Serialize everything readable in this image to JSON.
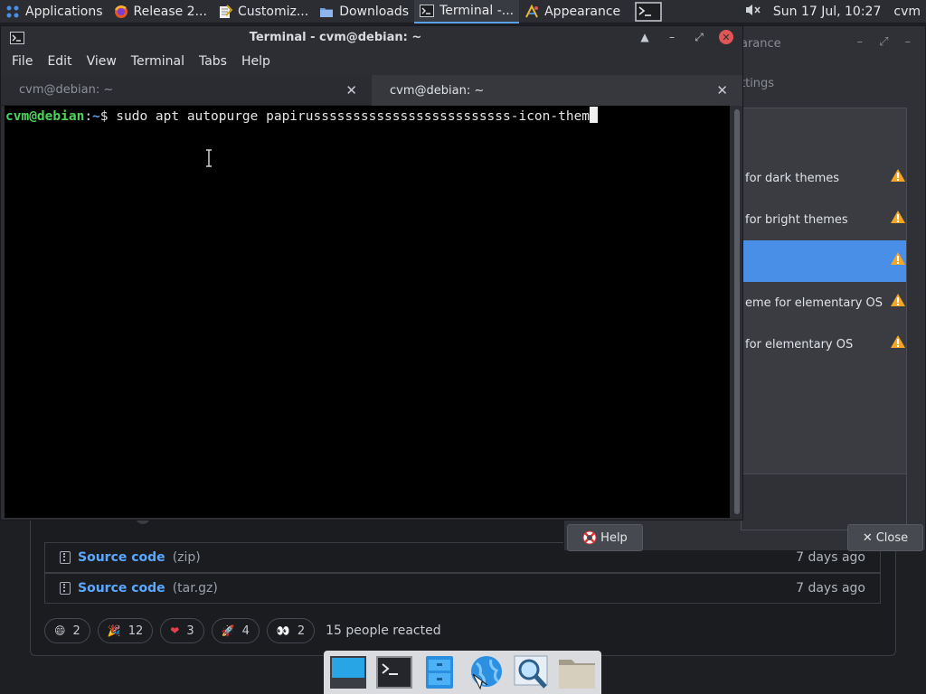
{
  "panel": {
    "items": [
      {
        "label": "Applications",
        "icon": "debian-swirl-icon"
      },
      {
        "label": "Release 2...",
        "icon": "firefox-icon"
      },
      {
        "label": "Customiz...",
        "icon": "settings-editor-icon"
      },
      {
        "label": "Downloads",
        "icon": "folder-icon"
      },
      {
        "label": "Terminal -...",
        "icon": "terminal-icon",
        "active": true
      },
      {
        "label": "Appearance",
        "icon": "appearance-icon"
      }
    ],
    "clock": "Sun 17 Jul, 10:27",
    "user": "cvm"
  },
  "terminal": {
    "title": "Terminal - cvm@debian: ~",
    "menu": [
      "File",
      "Edit",
      "View",
      "Terminal",
      "Tabs",
      "Help"
    ],
    "tabs": [
      {
        "label": "cvm@debian: ~",
        "active": false
      },
      {
        "label": "cvm@debian: ~",
        "active": true
      }
    ],
    "prompt_user": "cvm@debian",
    "prompt_sep": ":",
    "prompt_path": "~",
    "prompt_symbol": "$ ",
    "command": "sudo apt autopurge papirusssssssssssssssssssssssss-icon-them"
  },
  "appearance": {
    "title_fragment": "arance",
    "tab_fragment": "ttings",
    "themes": [
      {
        "label": "for dark themes",
        "selected": false
      },
      {
        "label": "for bright themes",
        "selected": false
      },
      {
        "label": "",
        "selected": true
      },
      {
        "label": "eme for elementary OS",
        "selected": false
      },
      {
        "label": "for elementary OS",
        "selected": false
      }
    ],
    "help_label": "Help",
    "close_label": "Close"
  },
  "release_page": {
    "assets": [
      {
        "name": "Source code",
        "ext": "(zip)",
        "age": "7 days ago"
      },
      {
        "name": "Source code",
        "ext": "(tar.gz)",
        "age": "7 days ago"
      }
    ],
    "reactions": [
      {
        "emoji": "😄",
        "count": "2"
      },
      {
        "emoji": "🎉",
        "count": "12"
      },
      {
        "emoji": "❤",
        "count": "3"
      },
      {
        "emoji": "🚀",
        "count": "4"
      },
      {
        "emoji": "👀",
        "count": "2"
      }
    ],
    "reactions_summary": "15 people reacted"
  },
  "dock": {
    "items": [
      "desktop-icon",
      "terminal-icon",
      "file-manager-icon",
      "web-browser-icon",
      "app-finder-icon",
      "folder-icon"
    ]
  },
  "colors": {
    "accent": "#4a8fe7",
    "prompt_user": "#4bd35a",
    "prompt_path": "#5ea0f0",
    "link": "#5aa8ff",
    "warning": "#f5a623"
  }
}
